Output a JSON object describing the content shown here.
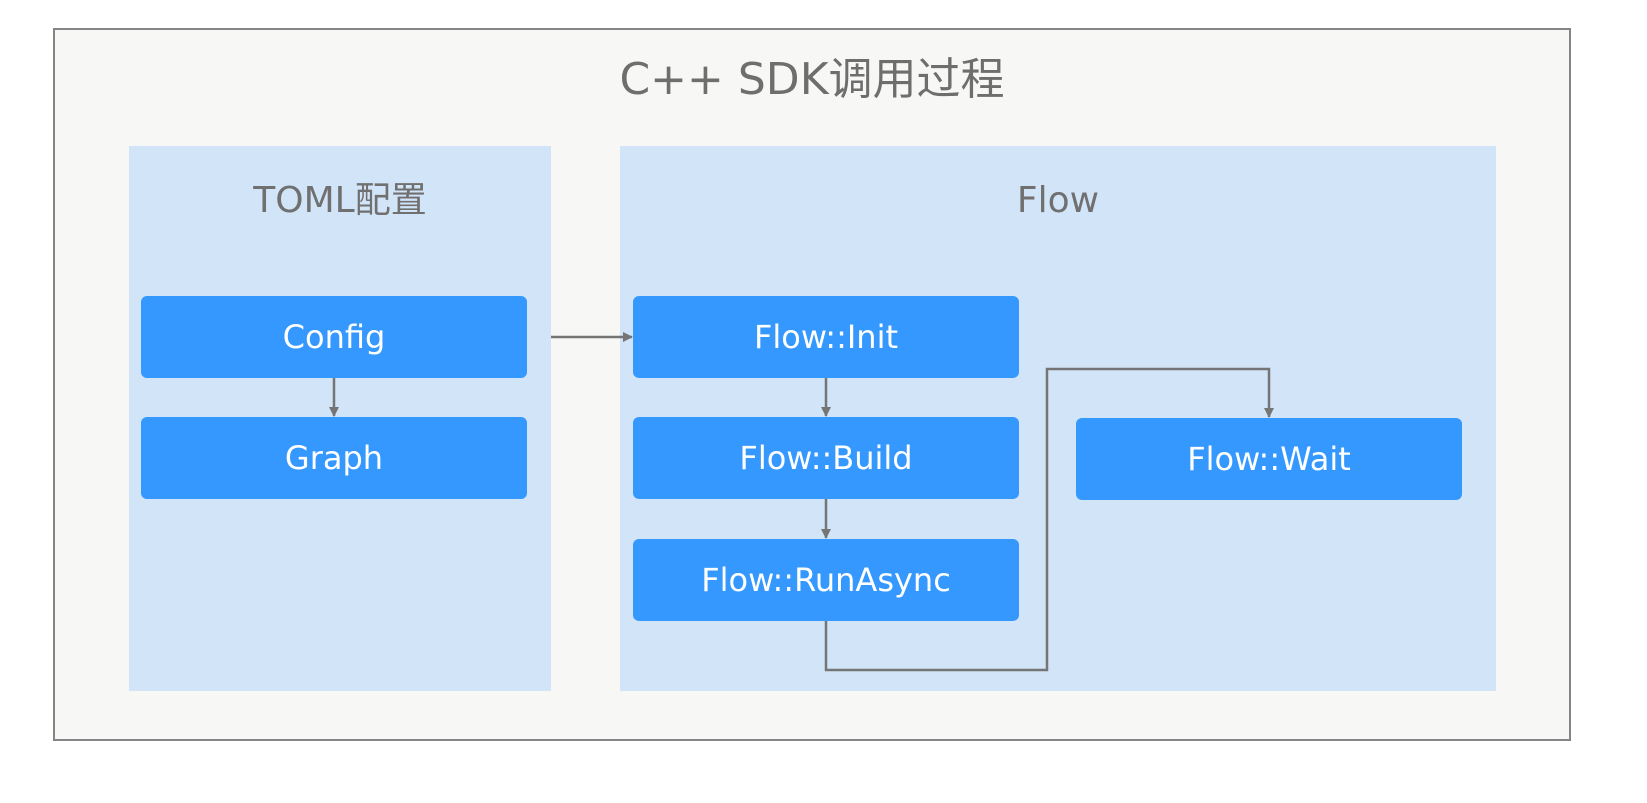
{
  "diagram": {
    "title": "C++ SDK调用过程",
    "groups": {
      "toml": {
        "title": "TOML配置",
        "nodes": {
          "config": "Config",
          "graph": "Graph"
        }
      },
      "flow": {
        "title": "Flow",
        "nodes": {
          "init": "Flow::Init",
          "build": "Flow::Build",
          "run_async": "Flow::RunAsync",
          "wait": "Flow::Wait"
        }
      }
    },
    "edges": [
      {
        "from": "Config",
        "to": "Graph"
      },
      {
        "from": "Config",
        "to": "Flow::Init"
      },
      {
        "from": "Flow::Init",
        "to": "Flow::Build"
      },
      {
        "from": "Flow::Build",
        "to": "Flow::RunAsync"
      },
      {
        "from": "Flow::RunAsync",
        "to": "Flow::Wait"
      }
    ],
    "colors": {
      "outer_background": "#f7f7f5",
      "outer_border": "#858585",
      "group_background": "#d2e5f8",
      "node_fill": "#3498fe",
      "node_text": "#ffffff",
      "connector": "#757575",
      "title_text": "#6e6e6e"
    }
  }
}
